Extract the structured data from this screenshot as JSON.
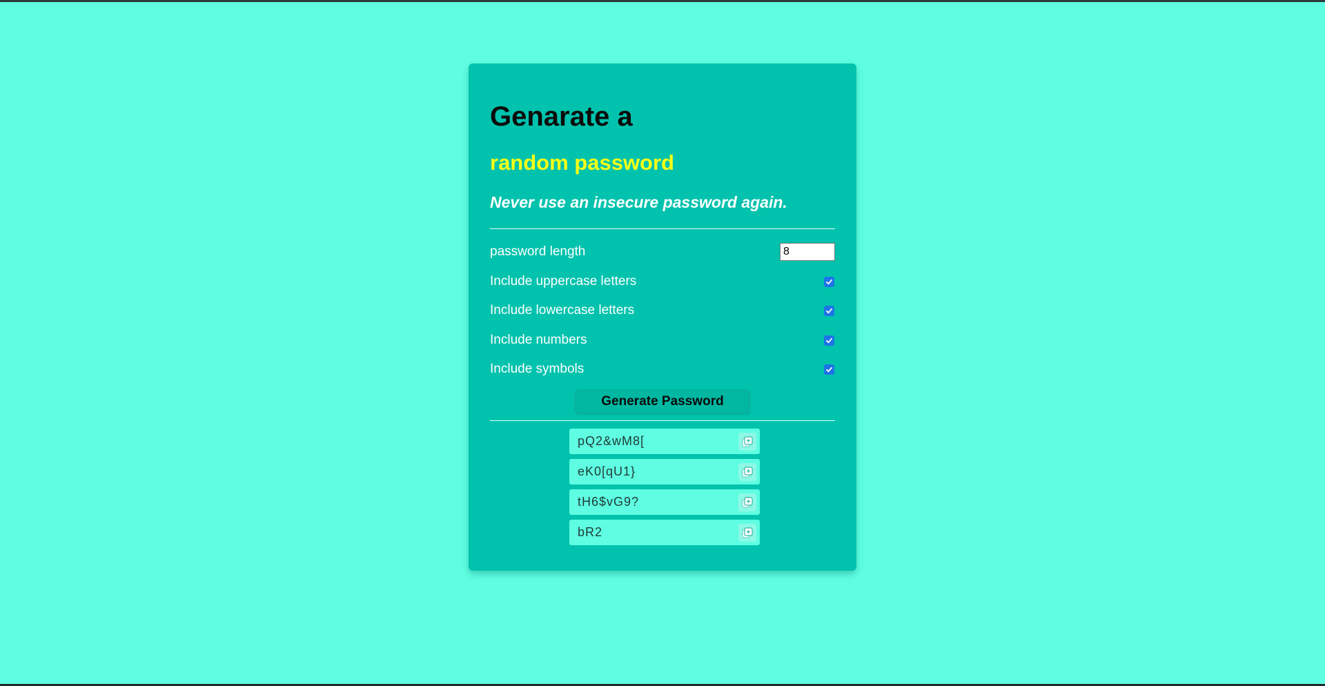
{
  "header": {
    "title": "Genarate a",
    "subtitle": "random password",
    "tagline": "Never use an insecure password again."
  },
  "options": {
    "length_label": "password length",
    "length_value": "8",
    "uppercase_label": "Include uppercase letters",
    "lowercase_label": "Include lowercase letters",
    "numbers_label": "Include numbers",
    "symbols_label": "Include symbols",
    "uppercase_checked": true,
    "lowercase_checked": true,
    "numbers_checked": true,
    "symbols_checked": true
  },
  "generate_button_label": "Generate Password",
  "passwords": [
    "pQ2&wM8[",
    "eK0[qU1}",
    "tH6$vG9?",
    "bR2"
  ],
  "icons": {
    "copy": "copy-icon",
    "checkbox": "checkmark-icon"
  },
  "colors": {
    "background": "#5ffee2",
    "card": "#00c2ad",
    "subtitle": "#f6ff17",
    "checkbox": "#1e73e8"
  }
}
